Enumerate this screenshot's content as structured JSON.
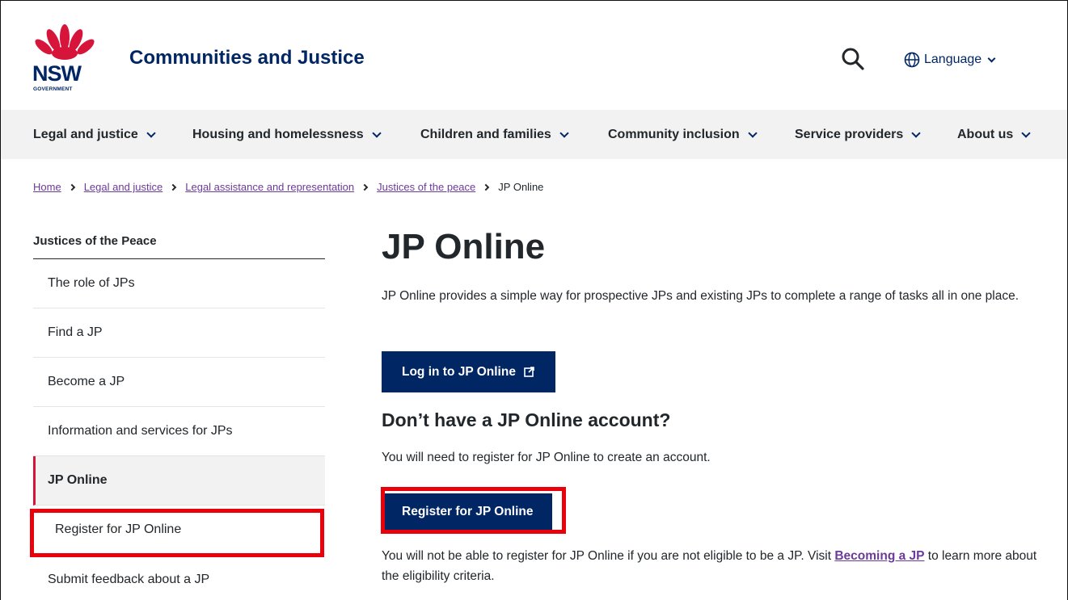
{
  "header": {
    "logo_text": "NSW",
    "logo_sub": "GOVERNMENT",
    "site_title": "Communities and Justice",
    "search_label": "",
    "language_label": "Language"
  },
  "nav": {
    "items": [
      {
        "label": "Legal and justice"
      },
      {
        "label": "Housing and homelessness"
      },
      {
        "label": "Children and families"
      },
      {
        "label": "Community inclusion"
      },
      {
        "label": "Service providers"
      },
      {
        "label": "About us"
      }
    ]
  },
  "breadcrumb": {
    "items": [
      "Home",
      "Legal and justice",
      "Legal assistance and representation",
      "Justices of the peace"
    ],
    "current": "JP Online"
  },
  "sidebar": {
    "heading": "Justices of the Peace",
    "items": [
      {
        "label": "The role of JPs"
      },
      {
        "label": "Find a JP"
      },
      {
        "label": "Become a JP"
      },
      {
        "label": "Information and services for JPs"
      },
      {
        "label": "JP Online"
      },
      {
        "label": "Register for JP Online"
      },
      {
        "label": "Submit feedback about a JP"
      }
    ]
  },
  "main": {
    "title": "JP Online",
    "intro": "JP Online provides a simple way for prospective JPs and existing JPs to complete a range of tasks all in one place.",
    "login_button": "Log in to JP Online",
    "no_account_heading": "Don’t have a JP Online account?",
    "need_register": "You will need to register for JP Online to create an account.",
    "register_button": "Register for JP Online",
    "note_before": "You will not be able to register for JP Online if you are not eligible to be a JP. Visit ",
    "note_link": "Becoming a JP",
    "note_after": " to learn more about the eligibility criteria."
  },
  "colors": {
    "brand_navy": "#002664",
    "accent_red": "#d7153a",
    "highlight_red": "#e8000b",
    "link_purple": "#6b3a9b"
  },
  "icons": [
    "waratah-logo",
    "search-icon",
    "globe-icon",
    "chevron-down-icon",
    "external-link-icon"
  ]
}
